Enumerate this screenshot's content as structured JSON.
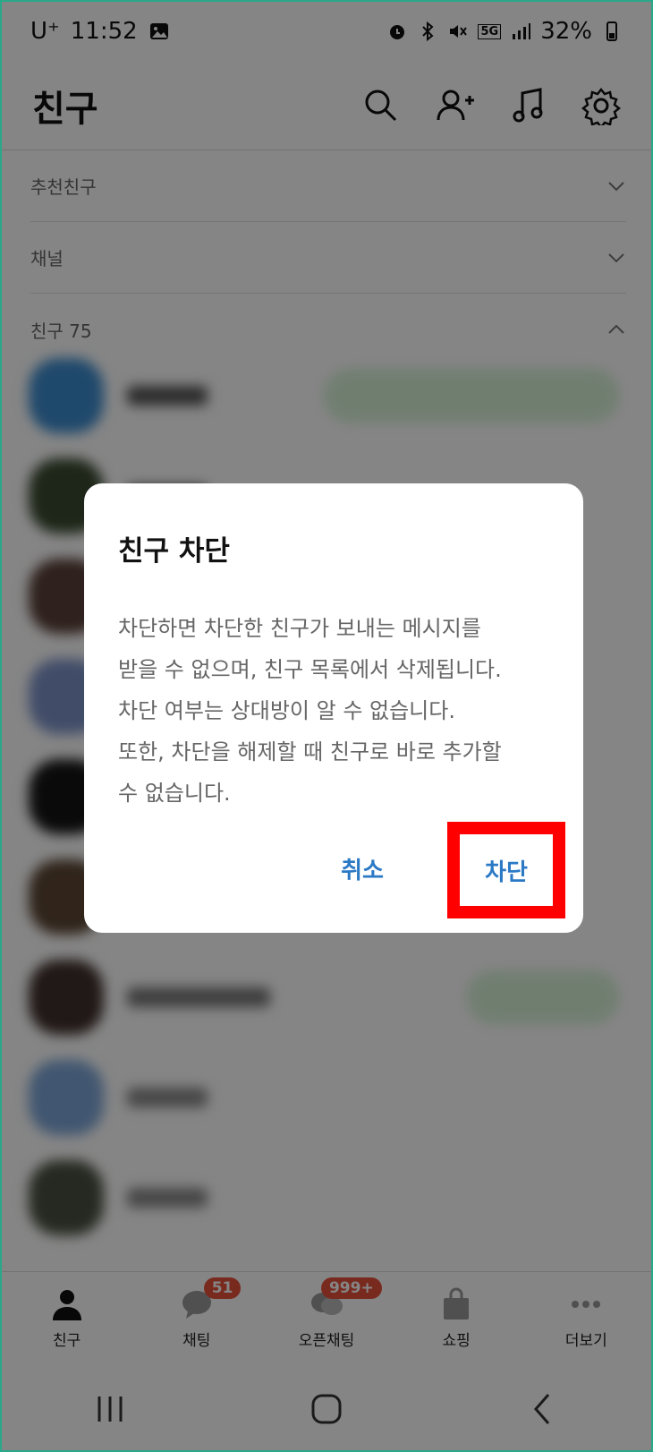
{
  "status_bar": {
    "carrier": "U⁺",
    "time": "11:52",
    "net": "5G",
    "battery": "32%"
  },
  "header": {
    "title": "친구"
  },
  "sections": [
    {
      "label": "추천친구"
    },
    {
      "label": "채널"
    },
    {
      "label": "친구 75"
    }
  ],
  "dialog": {
    "title": "친구 차단",
    "body_lines": [
      "차단하면 차단한 친구가 보내는 메시지를",
      "받을 수 없으며, 친구 목록에서 삭제됩니다.",
      "차단 여부는 상대방이 알 수 없습니다.",
      "또한, 차단을 해제할 때 친구로 바로 추가할",
      "수 없습니다."
    ],
    "cancel_label": "취소",
    "block_label": "차단"
  },
  "bottom_nav": [
    {
      "label": "친구",
      "icon": "person-icon"
    },
    {
      "label": "채팅",
      "icon": "chat-bubble-icon",
      "badge": "51"
    },
    {
      "label": "오픈채팅",
      "icon": "open-chat-icon",
      "badge": "999+"
    },
    {
      "label": "쇼핑",
      "icon": "shopping-bag-icon"
    },
    {
      "label": "더보기",
      "icon": "more-dots-icon"
    }
  ],
  "colors": {
    "accent": "#2b79c5",
    "highlight": "#ff0000",
    "badge": "#e8513b"
  }
}
